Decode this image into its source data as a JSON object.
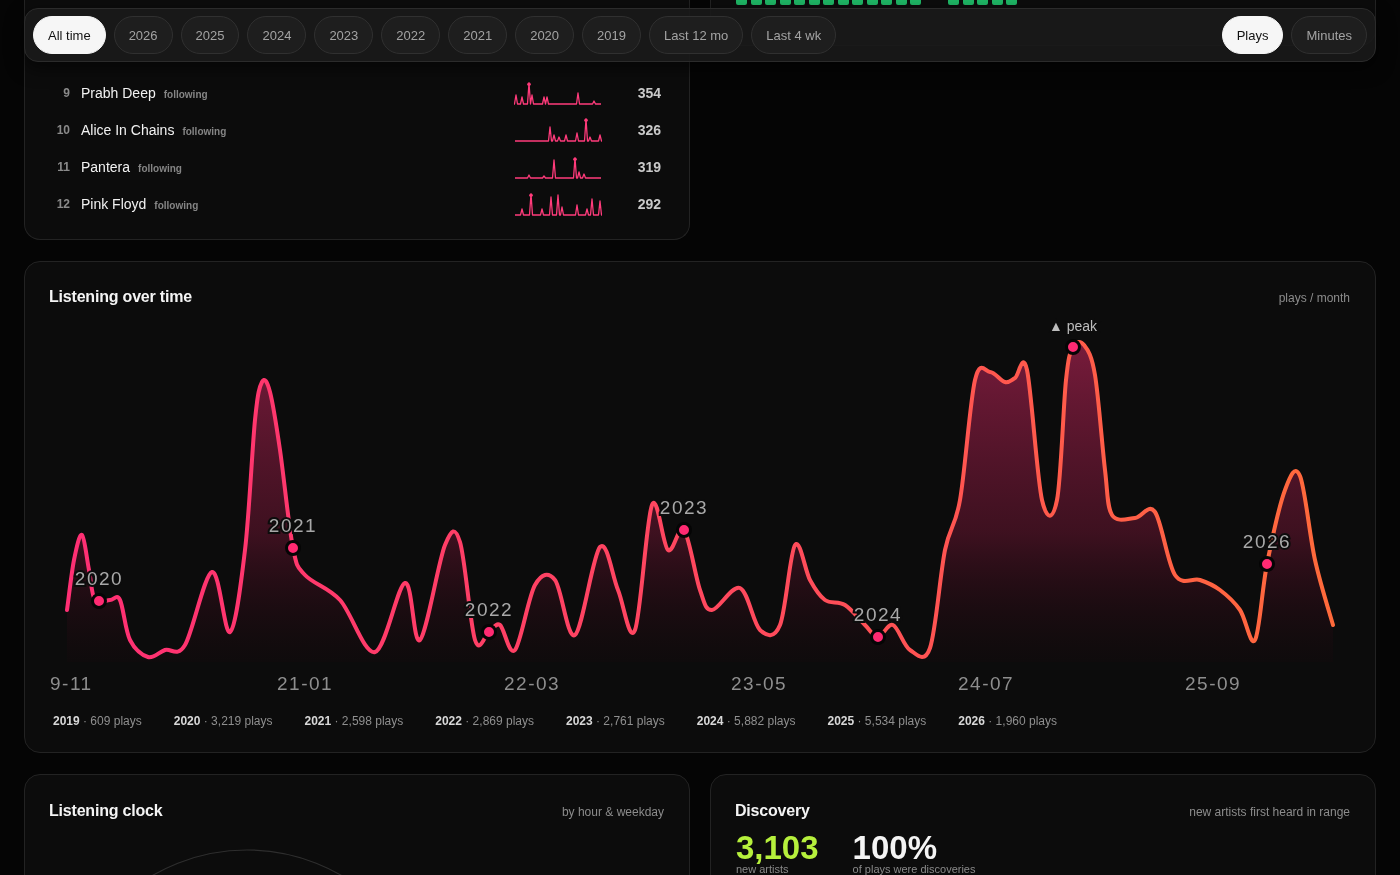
{
  "filter_bar": {
    "ranges": [
      {
        "label": "All time",
        "selected": true
      },
      {
        "label": "2026",
        "selected": false
      },
      {
        "label": "2025",
        "selected": false
      },
      {
        "label": "2024",
        "selected": false
      },
      {
        "label": "2023",
        "selected": false
      },
      {
        "label": "2022",
        "selected": false
      },
      {
        "label": "2021",
        "selected": false
      },
      {
        "label": "2020",
        "selected": false
      },
      {
        "label": "2019",
        "selected": false
      },
      {
        "label": "Last 12 mo",
        "selected": false
      },
      {
        "label": "Last 4 wk",
        "selected": false
      }
    ],
    "metrics": [
      {
        "label": "Plays",
        "selected": true
      },
      {
        "label": "Minutes",
        "selected": false
      }
    ]
  },
  "top_artists": {
    "rows": [
      {
        "rank": "9",
        "name": "Prabh Deep",
        "tag": "following",
        "plays": "354"
      },
      {
        "rank": "10",
        "name": "Alice In Chains",
        "tag": "following",
        "plays": "326"
      },
      {
        "rank": "11",
        "name": "Pantera",
        "tag": "following",
        "plays": "319"
      },
      {
        "rank": "12",
        "name": "Pink Floyd",
        "tag": "following",
        "plays": "292"
      }
    ]
  },
  "listening_over_time": {
    "title": "Listening over time",
    "unit": "plays / month",
    "markers": [
      {
        "kind": "year",
        "label": "2020"
      },
      {
        "kind": "year",
        "label": "2021"
      },
      {
        "kind": "year",
        "label": "2022"
      },
      {
        "kind": "year",
        "label": "2023"
      },
      {
        "kind": "year",
        "label": "2024"
      },
      {
        "kind": "peak",
        "label": "▲ peak"
      },
      {
        "kind": "year",
        "label": "2026"
      }
    ],
    "x_labels": [
      "9-11",
      "21-01",
      "22-03",
      "23-05",
      "24-07",
      "25-09"
    ],
    "year_totals": [
      "**2019** · 609 plays",
      "**2020** · 3,219 plays",
      "**2021** · 2,598 plays",
      "**2022** · 2,869 plays",
      "**2023** · 2,761 plays",
      "**2024** · 5,882 plays",
      "**2025** · 5,534 plays",
      "**2026** · 1,960 plays"
    ]
  },
  "listening_clock": {
    "title": "Listening clock",
    "subtitle": "by hour & weekday"
  },
  "discovery": {
    "title": "Discovery",
    "subtitle": "new artists first heard in range",
    "stats": [
      {
        "kind": "highlight",
        "value": "3,103",
        "label": "new artists"
      },
      {
        "kind": "plain",
        "value": "100%",
        "label": "of plays were discoveries"
      }
    ]
  }
}
